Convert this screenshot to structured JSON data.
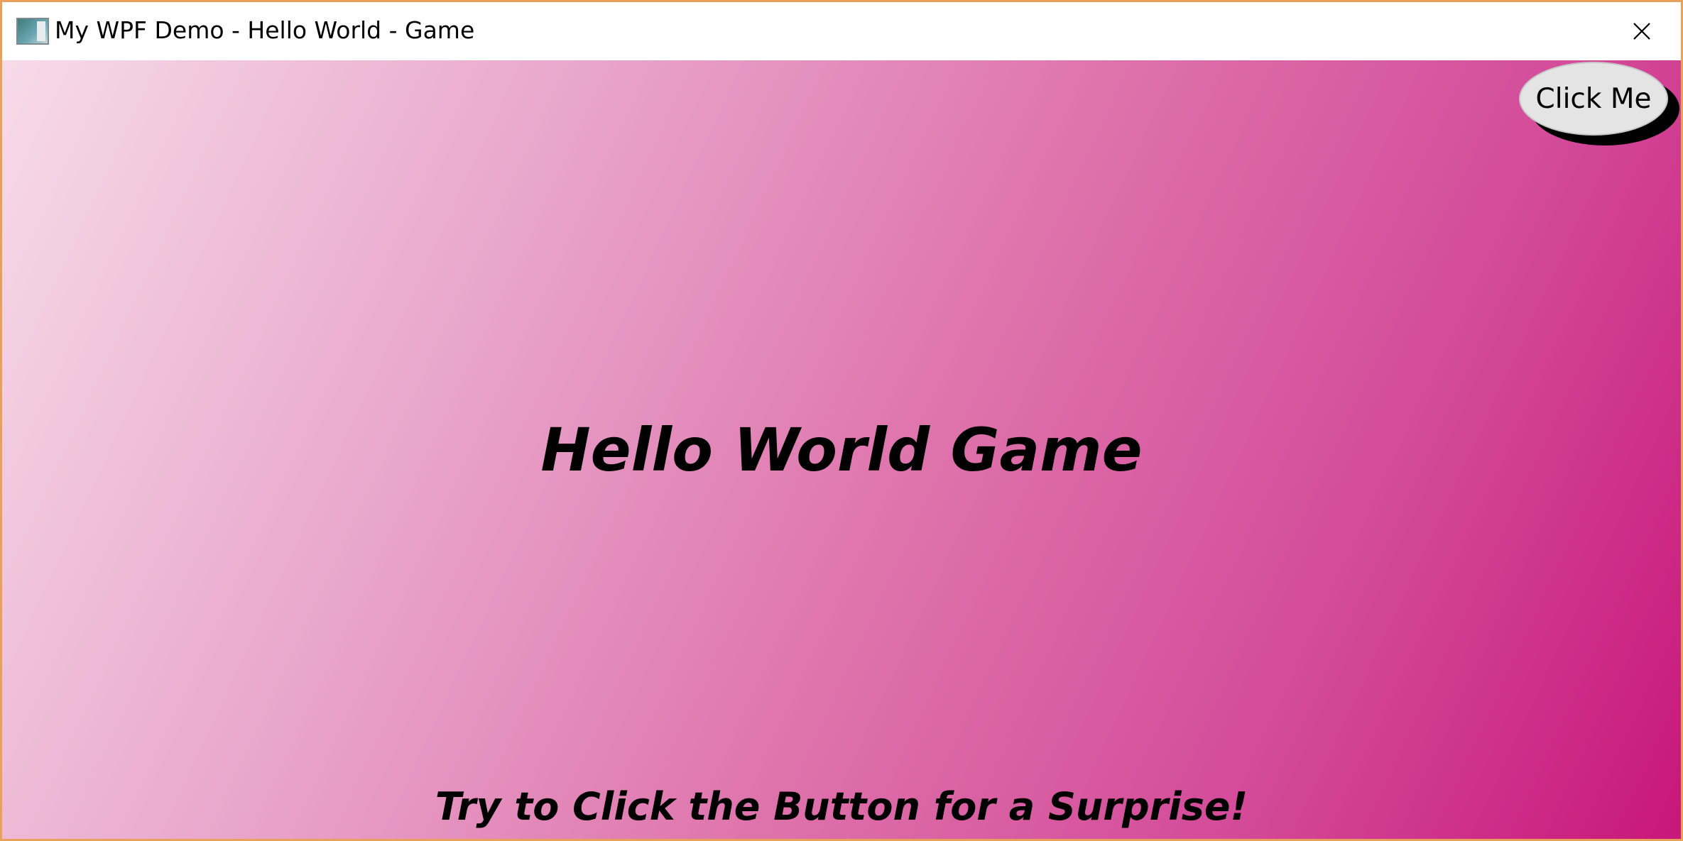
{
  "window": {
    "title": "My WPF Demo - Hello World - Game",
    "app_icon": "wpf-app-icon",
    "close_icon": "close-icon",
    "border_color": "#e8a15a"
  },
  "game": {
    "button_label": "Click Me",
    "heading": "Hello World Game",
    "hint": "Try to Click the Button for a Surprise!",
    "background_gradient": [
      "#f7dbe9",
      "#e9a7cc",
      "#de72ab",
      "#d34a99",
      "#c8177a"
    ]
  }
}
